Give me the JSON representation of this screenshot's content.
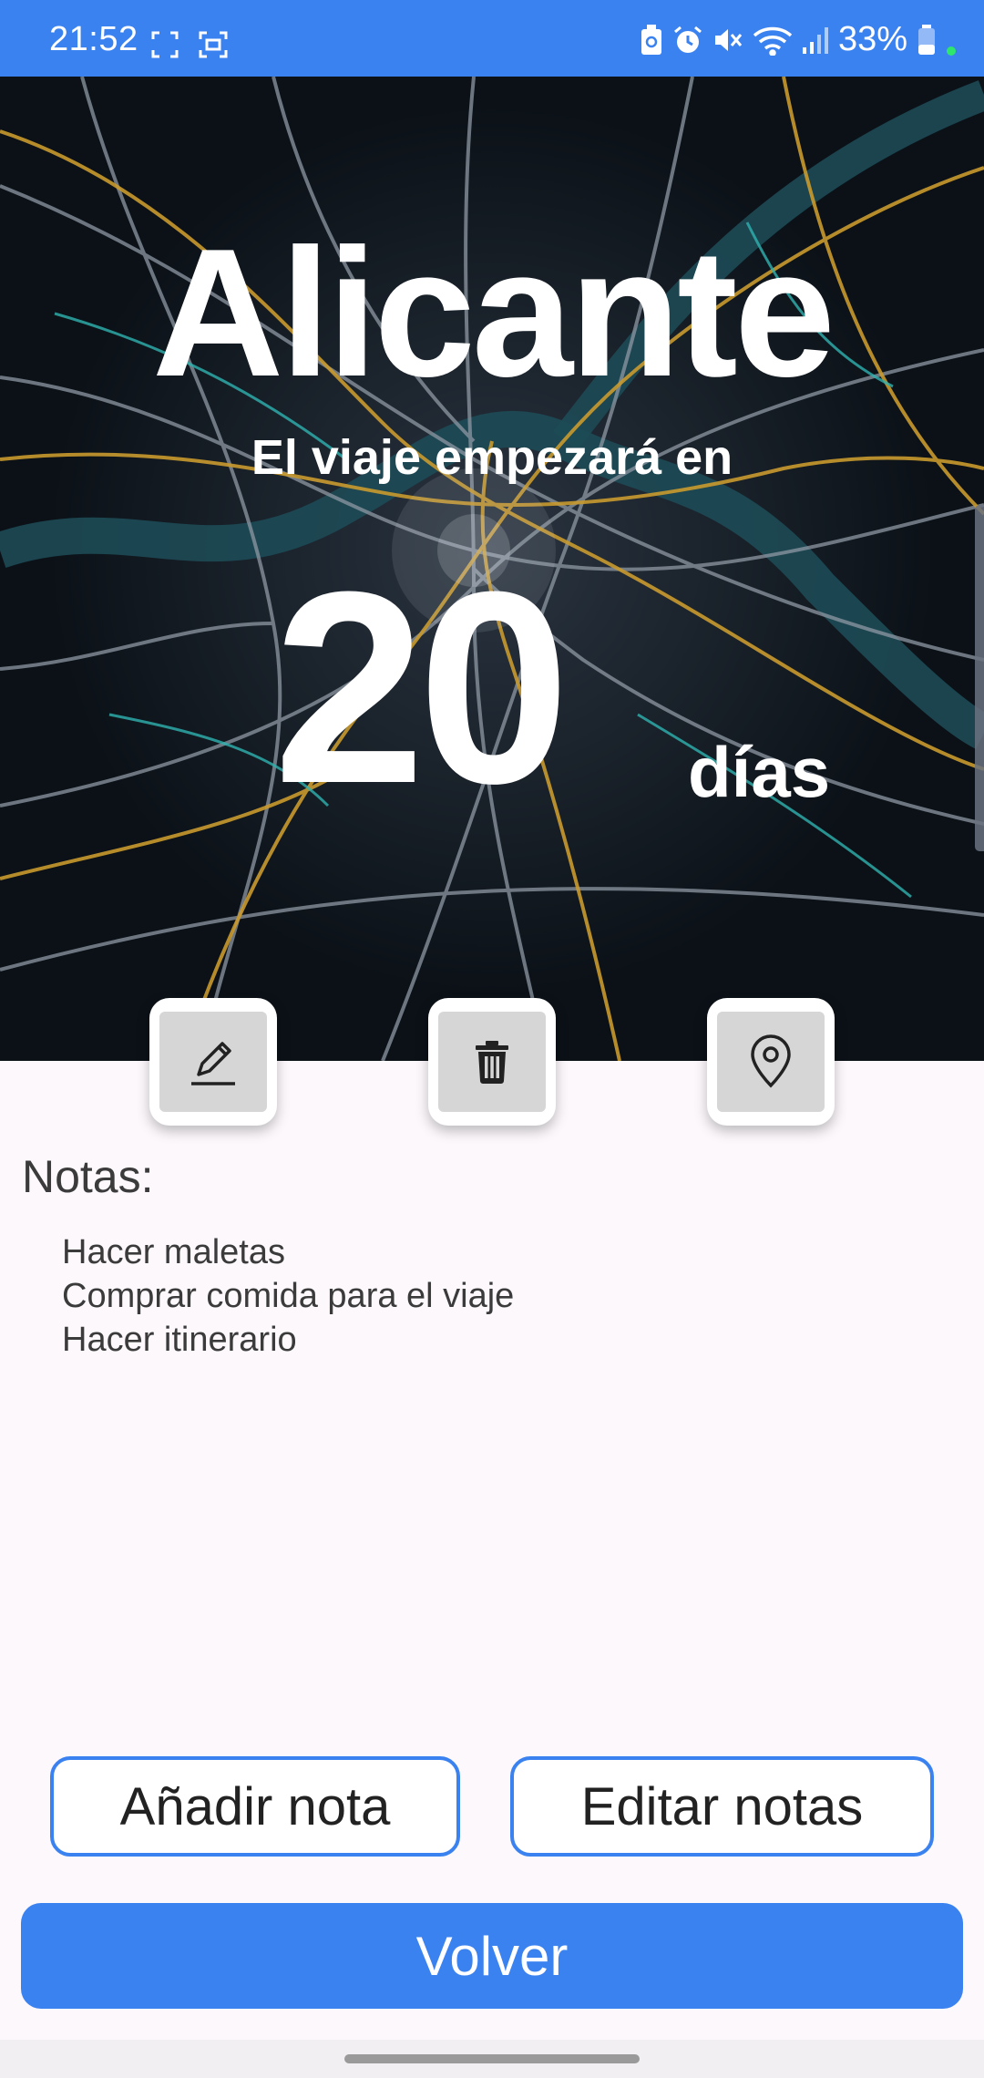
{
  "status_bar": {
    "time": "21:52",
    "battery_percent": "33%",
    "icons": [
      "screenshot-frame-icon",
      "screen-capture-icon",
      "battery-saver-icon",
      "alarm-icon",
      "mute-icon",
      "wifi-icon",
      "signal-icon",
      "battery-icon"
    ]
  },
  "trip": {
    "destination": "Alicante",
    "countdown_label": "El viaje empezará en",
    "days_remaining": "20",
    "days_unit": "días"
  },
  "actions": {
    "edit_icon": "pencil-icon",
    "delete_icon": "trash-icon",
    "location_icon": "map-pin-icon"
  },
  "notes": {
    "title": "Notas:",
    "items": [
      "Hacer maletas",
      "Comprar comida para el viaje",
      "Hacer itinerario"
    ]
  },
  "buttons": {
    "add_note": "Añadir nota",
    "edit_notes": "Editar notas",
    "back": "Volver"
  },
  "colors": {
    "accent": "#3b82f1",
    "background": "#fcf8fc",
    "map_background": "#0b1117"
  }
}
